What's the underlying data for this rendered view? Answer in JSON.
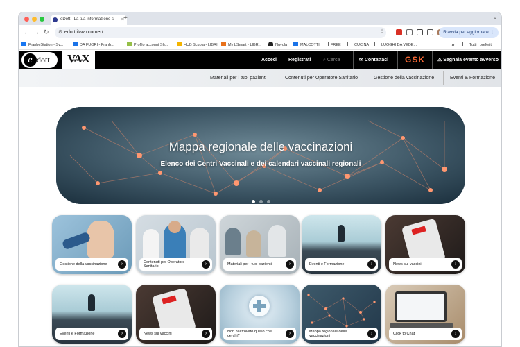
{
  "browser": {
    "tab_title": "eDott - La tua informazione s",
    "url": "edott.it/vaxcorner/",
    "update_label": "Riavvia per aggiornare",
    "new_tab": "+"
  },
  "bookmarks": [
    {
      "label": "FranbeStation - Sy...",
      "color": "#1877f2"
    },
    {
      "label": "DA FUORI - Franb...",
      "color": "#1a73e8"
    },
    {
      "label": "Profilo account Sh...",
      "color": "#95bf47"
    },
    {
      "label": "HUB Scuola - LIBRI",
      "color": "#f4b400"
    },
    {
      "label": "My bSmart - LIBR...",
      "color": "#e8711a"
    },
    {
      "label": "Nuvola",
      "color": "#222222"
    },
    {
      "label": "MALCOTTI",
      "color": "#1a73e8"
    },
    {
      "label": "FREE",
      "color": "#666666"
    },
    {
      "label": "CUCINA",
      "color": "#666666"
    },
    {
      "label": "LUOGHI DA VEDE...",
      "color": "#666666"
    }
  ],
  "bookmarks_more": "»",
  "bookmarks_all": "Tutti i preferiti",
  "site": {
    "logo_text": "dott",
    "logo_e": "e",
    "vax_logo": "VAX",
    "vax_sub": "CORNER",
    "nav": {
      "login": "Accedi",
      "register": "Registrati",
      "search_placeholder": "Cerca",
      "contacts": "Contattaci",
      "brand": "GSK",
      "report": "Segnala evento avverso"
    },
    "subnav": [
      "Materiali per i tuoi pazienti",
      "Contenuti per Operatore Sanitario",
      "Gestione della vaccinazione",
      "Eventi & Formazione"
    ]
  },
  "hero": {
    "title": "Mappa regionale delle vaccinazioni",
    "subtitle": "Elenco dei Centri Vaccinali e dei calendari vaccinali regionali"
  },
  "cards_row1": [
    "Gestione della vaccinazione",
    "Contenuti per Operatore Sanitario",
    "Materiali per i tuoi pazienti",
    "Eventi e Formazione",
    "News sui vaccini"
  ],
  "cards_row2": [
    "Eventi e Formazione",
    "News sui vaccini",
    "Non hai trovato quello che cerchi?",
    "Mappa regionale delle vaccinazioni",
    "Click to Chat"
  ],
  "arrow": "›",
  "colors": {
    "brand_black": "#000000",
    "gsk_orange": "#f36633",
    "hero_bg": "#2f4756"
  }
}
